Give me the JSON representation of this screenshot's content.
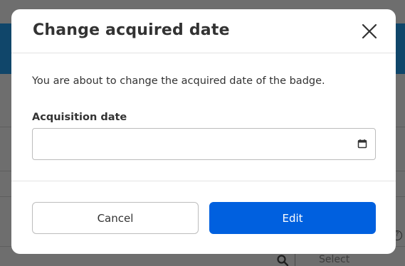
{
  "modal": {
    "title": "Change acquired date",
    "description": "You are about to change the acquired date of the badge.",
    "field_label": "Acquisition date",
    "date_value": "",
    "cancel_label": "Cancel",
    "edit_label": "Edit"
  },
  "background": {
    "select_placeholder": "Select",
    "help_glyph": "?"
  },
  "colors": {
    "primary": "#0060df",
    "header_bg": "#10466a",
    "overlay": "#6e6e6e"
  },
  "icons": [
    "close-icon",
    "calendar-icon",
    "search-icon",
    "help-icon"
  ]
}
